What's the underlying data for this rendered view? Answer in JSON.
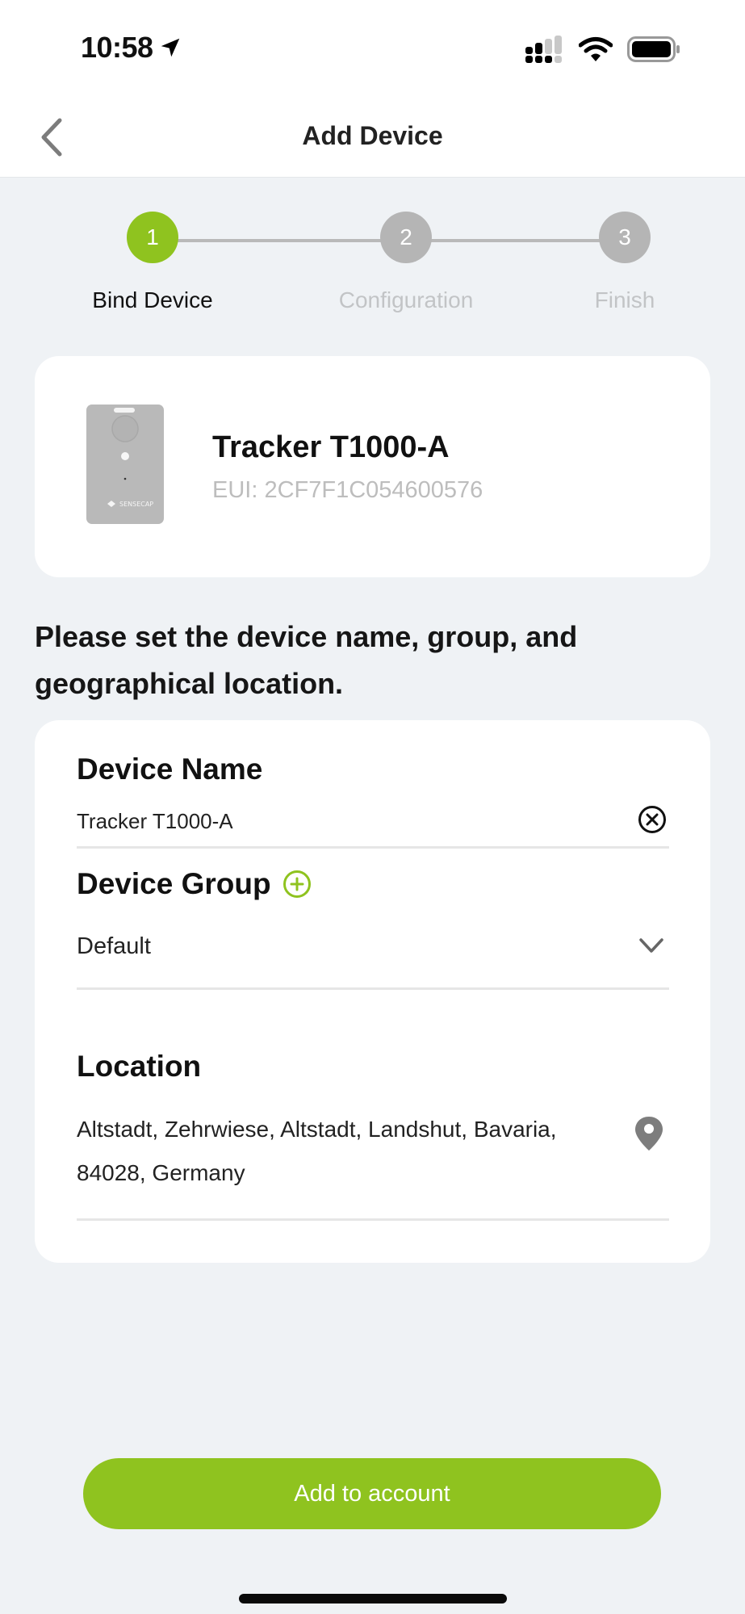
{
  "status_bar": {
    "time": "10:58",
    "icons": [
      "location-arrow-icon",
      "cellular-signal-icon",
      "wifi-icon",
      "battery-icon"
    ]
  },
  "nav": {
    "title": "Add Device",
    "back_icon": "chevron-left-icon"
  },
  "stepper": {
    "current_step": 1,
    "steps": [
      {
        "number": "1",
        "label": "Bind Device",
        "state": "active"
      },
      {
        "number": "2",
        "label": "Configuration",
        "state": "inactive"
      },
      {
        "number": "3",
        "label": "Finish",
        "state": "inactive"
      }
    ]
  },
  "device": {
    "name": "Tracker T1000-A",
    "eui": "EUI: 2CF7F1C054600576",
    "image_brand": "SENSECAP"
  },
  "instructions": "Please set the device name, group, and geographical location.",
  "form": {
    "device_name": {
      "label": "Device Name",
      "value": "Tracker T1000-A",
      "clear_icon": "clear-circle-icon"
    },
    "device_group": {
      "label": "Device Group",
      "add_icon": "add-circle-icon",
      "selected": "Default",
      "dropdown_icon": "chevron-down-icon"
    },
    "location": {
      "label": "Location",
      "value": "Altstadt, Zehrwiese, Altstadt, Landshut, Bavaria, 84028, Germany",
      "pin_icon": "map-pin-icon"
    }
  },
  "actions": {
    "submit_label": "Add to account"
  },
  "colors": {
    "accent": "#8fc31f",
    "inactive_step": "#b5b5b5",
    "background": "#eff2f5",
    "muted_text": "#bdbdbd"
  }
}
